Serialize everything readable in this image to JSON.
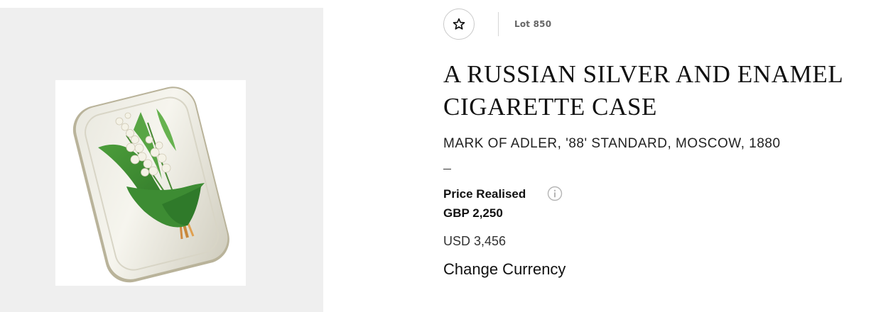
{
  "lot": {
    "favorite_icon": "star-icon",
    "lot_number": "Lot 850",
    "title": "A RUSSIAN SILVER AND ENAMEL CIGARETTE CASE",
    "subtitle": "MARK OF ADLER, '88' STANDARD, MOSCOW, 1880",
    "dash": "–"
  },
  "pricing": {
    "label": "Price Realised",
    "info_icon": "info-icon",
    "primary": "GBP 2,250",
    "secondary": "USD 3,456",
    "change_currency_label": "Change Currency"
  },
  "image": {
    "subject": "cigarette-case-photo"
  },
  "colors": {
    "panel_bg": "#efefef",
    "text": "#111111",
    "muted": "#666666"
  }
}
